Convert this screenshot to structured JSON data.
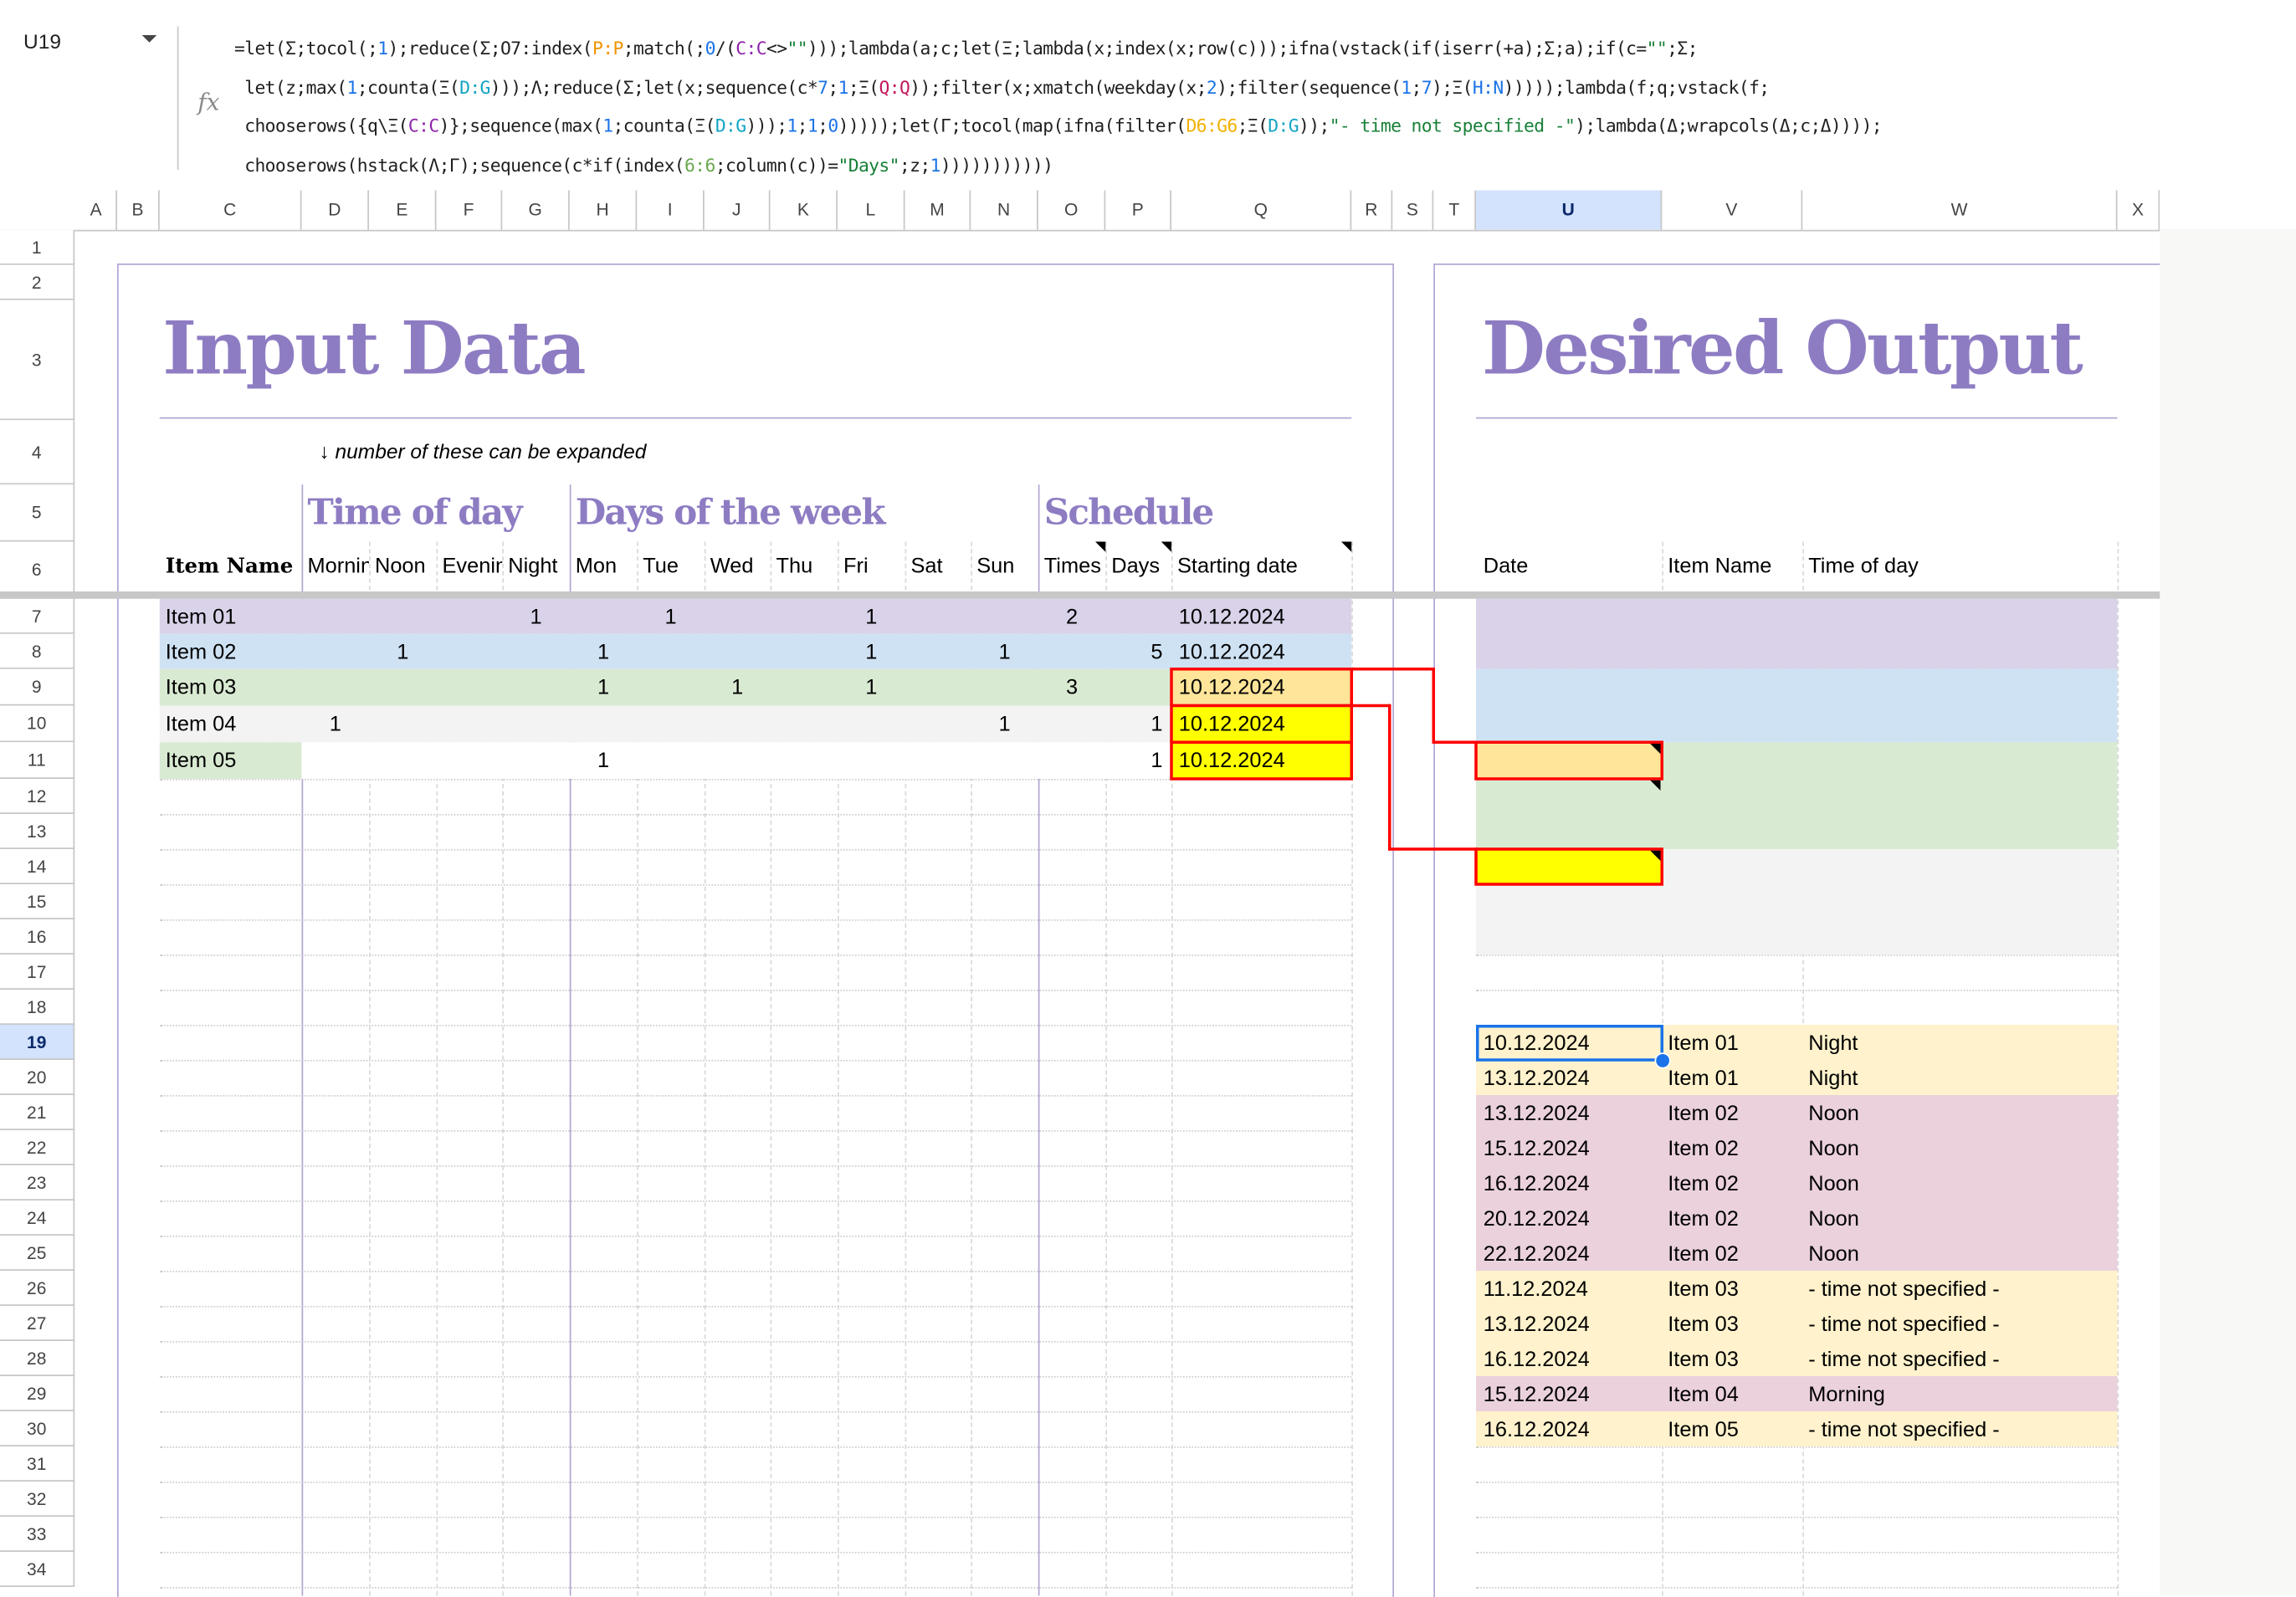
{
  "formula_bar": {
    "name_box": "U19",
    "fx_icon": "function-icon",
    "formula_lines": [
      "=let(Σ;tocol(;1);reduce(Σ;O7:index(P:P;match(;0/(C:C<>\"\")));lambda(a;c;let(Ξ;lambda(x;index(x;row(c)));ifna(vstack(if(iserr(+a);Σ;a);if(c=\"\";Σ;",
      " let(z;max(1;counta(Ξ(D:G)));Λ;reduce(Σ;let(x;sequence(c*7;1;Ξ(Q:Q));filter(x;xmatch(weekday(x;2);filter(sequence(1;7);Ξ(H:N)))));lambda(f;q;vstack(f;",
      " chooserows({q\\Ξ(C:C)};sequence(max(1;counta(Ξ(D:G)));1;1;0)))));let(Γ;tocol(map(ifna(filter(D6:G6;Ξ(D:G));\"- time not specified -\");lambda(Δ;wrapcols(Δ;c;Δ))));",
      " chooserows(hstack(Λ;Γ);sequence(c*if(index(6:6;column(c))=\"Days\";z;1)))))))))))"
    ]
  },
  "sheet": {
    "columns": [
      "A",
      "B",
      "C",
      "D",
      "E",
      "F",
      "G",
      "H",
      "I",
      "J",
      "K",
      "L",
      "M",
      "N",
      "O",
      "P",
      "Q",
      "R",
      "S",
      "T",
      "U",
      "V",
      "W",
      "X"
    ],
    "selected_column": "U",
    "rows": [
      1,
      2,
      3,
      4,
      5,
      6,
      7,
      8,
      9,
      10,
      11,
      12,
      13,
      14,
      15,
      16,
      17,
      18,
      19,
      20,
      21,
      22,
      23,
      24,
      25,
      26,
      27,
      28,
      29,
      30,
      31,
      32,
      33,
      34
    ],
    "selected_row": 19,
    "selected_cell": "U19"
  },
  "input": {
    "title": "Input Data",
    "note": "↓ number of these can be expanded",
    "sections": {
      "time_of_day": "Time of day",
      "days_of_week": "Days of the week",
      "schedule": "Schedule"
    },
    "headers": {
      "item_name": "Item Name",
      "morning": "Morning",
      "noon": "Noon",
      "evening": "Evening",
      "night": "Night",
      "mon": "Mon",
      "tue": "Tue",
      "wed": "Wed",
      "thu": "Thu",
      "fri": "Fri",
      "sat": "Sat",
      "sun": "Sun",
      "times": "Times",
      "days": "Days",
      "starting_date": "Starting date"
    },
    "rows": [
      {
        "name": "Item 01",
        "morning": "",
        "noon": "",
        "evening": "",
        "night": "1",
        "mon": "",
        "tue": "1",
        "wed": "",
        "thu": "",
        "fri": "1",
        "sat": "",
        "sun": "",
        "times": "2",
        "days": "",
        "start": "10.12.2024",
        "color": "#d9d2e9"
      },
      {
        "name": "Item 02",
        "morning": "",
        "noon": "1",
        "evening": "",
        "night": "",
        "mon": "1",
        "tue": "",
        "wed": "",
        "thu": "",
        "fri": "1",
        "sat": "",
        "sun": "1",
        "times": "",
        "days": "5",
        "start": "10.12.2024",
        "color": "#cfe2f3"
      },
      {
        "name": "Item 03",
        "morning": "",
        "noon": "",
        "evening": "",
        "night": "",
        "mon": "1",
        "tue": "",
        "wed": "1",
        "thu": "",
        "fri": "1",
        "sat": "",
        "sun": "",
        "times": "3",
        "days": "",
        "start": "10.12.2024",
        "color": "#d9ead3",
        "start_highlight": "#ffe599"
      },
      {
        "name": "Item 04",
        "morning": "1",
        "noon": "",
        "evening": "",
        "night": "",
        "mon": "",
        "tue": "",
        "wed": "",
        "thu": "",
        "fri": "",
        "sat": "",
        "sun": "1",
        "times": "",
        "days": "1",
        "start": "10.12.2024",
        "color": "#f3f3f3",
        "start_highlight": "#ffff00"
      },
      {
        "name": "Item 05",
        "morning": "",
        "noon": "",
        "evening": "",
        "night": "",
        "mon": "1",
        "tue": "",
        "wed": "",
        "thu": "",
        "fri": "",
        "sat": "",
        "sun": "",
        "times": "",
        "days": "1",
        "start": "10.12.2024",
        "color": "#ffffff",
        "name_color": "#d9ead3",
        "start_highlight": "#ffff00"
      }
    ]
  },
  "output": {
    "title": "Desired Output",
    "headers": {
      "date": "Date",
      "item_name": "Item Name",
      "time_of_day": "Time of day"
    },
    "bands": [
      {
        "color": "#d9d2e9",
        "rows": 2
      },
      {
        "color": "#cfe2f3",
        "rows": 2
      },
      {
        "color": "#d9ead3",
        "rows": 3
      },
      {
        "color": "#f3f3f3",
        "rows": 3
      }
    ],
    "highlight_cells": [
      {
        "row": 11,
        "color": "#ffe599"
      },
      {
        "row": 14,
        "color": "#ffff00"
      }
    ],
    "rows": [
      {
        "date": "10.12.2024",
        "item": "Item 01",
        "time": "Night",
        "color": "#fff2cc"
      },
      {
        "date": "13.12.2024",
        "item": "Item 01",
        "time": "Night",
        "color": "#fff2cc"
      },
      {
        "date": "13.12.2024",
        "item": "Item 02",
        "time": "Noon",
        "color": "#ead1dc"
      },
      {
        "date": "15.12.2024",
        "item": "Item 02",
        "time": "Noon",
        "color": "#ead1dc"
      },
      {
        "date": "16.12.2024",
        "item": "Item 02",
        "time": "Noon",
        "color": "#ead1dc"
      },
      {
        "date": "20.12.2024",
        "item": "Item 02",
        "time": "Noon",
        "color": "#ead1dc"
      },
      {
        "date": "22.12.2024",
        "item": "Item 02",
        "time": "Noon",
        "color": "#ead1dc"
      },
      {
        "date": "11.12.2024",
        "item": "Item 03",
        "time": "- time not specified -",
        "color": "#fff2cc"
      },
      {
        "date": "13.12.2024",
        "item": "Item 03",
        "time": "- time not specified -",
        "color": "#fff2cc"
      },
      {
        "date": "16.12.2024",
        "item": "Item 03",
        "time": "- time not specified -",
        "color": "#fff2cc"
      },
      {
        "date": "15.12.2024",
        "item": "Item 04",
        "time": "Morning",
        "color": "#ead1dc"
      },
      {
        "date": "16.12.2024",
        "item": "Item 05",
        "time": "- time not specified -",
        "color": "#fff2cc"
      }
    ]
  },
  "colors": {
    "accent_purple": "#8e7cc3",
    "frame_purple": "#b4a7d6",
    "annotation_red": "#ff0000",
    "selection_blue": "#1a73e8"
  }
}
